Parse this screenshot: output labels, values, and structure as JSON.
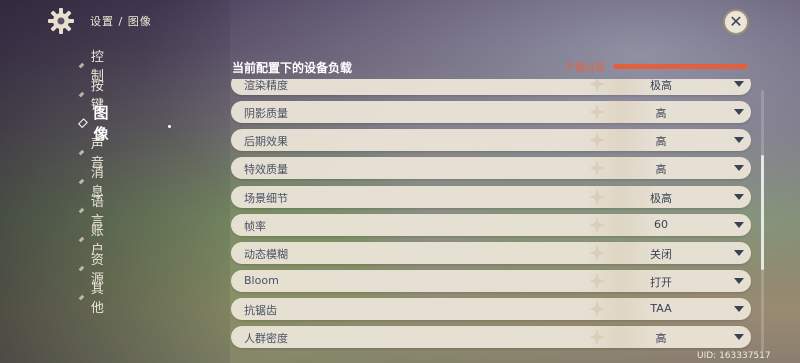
{
  "header": {
    "breadcrumb": "设置 / 图像",
    "close_icon": "close-icon",
    "settings_icon": "gear-icon"
  },
  "sidebar": {
    "items": [
      {
        "label": "控制",
        "active": false
      },
      {
        "label": "按键",
        "active": false
      },
      {
        "label": "图像",
        "active": true
      },
      {
        "label": "声音",
        "active": false
      },
      {
        "label": "消息",
        "active": false
      },
      {
        "label": "语言",
        "active": false
      },
      {
        "label": "账户",
        "active": false
      },
      {
        "label": "资源",
        "active": false
      },
      {
        "label": "其他",
        "active": false
      }
    ]
  },
  "load": {
    "title": "当前配置下的设备负载",
    "status": "严重过高",
    "level": 1.0,
    "color": "#e0603f"
  },
  "settings": {
    "rows": [
      {
        "name": "渲染精度",
        "value": "极高"
      },
      {
        "name": "阴影质量",
        "value": "高"
      },
      {
        "name": "后期效果",
        "value": "高"
      },
      {
        "name": "特效质量",
        "value": "高"
      },
      {
        "name": "场景细节",
        "value": "极高"
      },
      {
        "name": "帧率",
        "value": "60"
      },
      {
        "name": "动态模糊",
        "value": "关闭"
      },
      {
        "name": "Bloom",
        "value": "打开"
      },
      {
        "name": "抗锯齿",
        "value": "TAA"
      },
      {
        "name": "人群密度",
        "value": "高"
      }
    ]
  },
  "footer": {
    "uid": "UID: 163337517"
  },
  "colors": {
    "row_bg": "#ece5d8",
    "text_dark": "#3b4255",
    "warning": "#e3643f"
  }
}
